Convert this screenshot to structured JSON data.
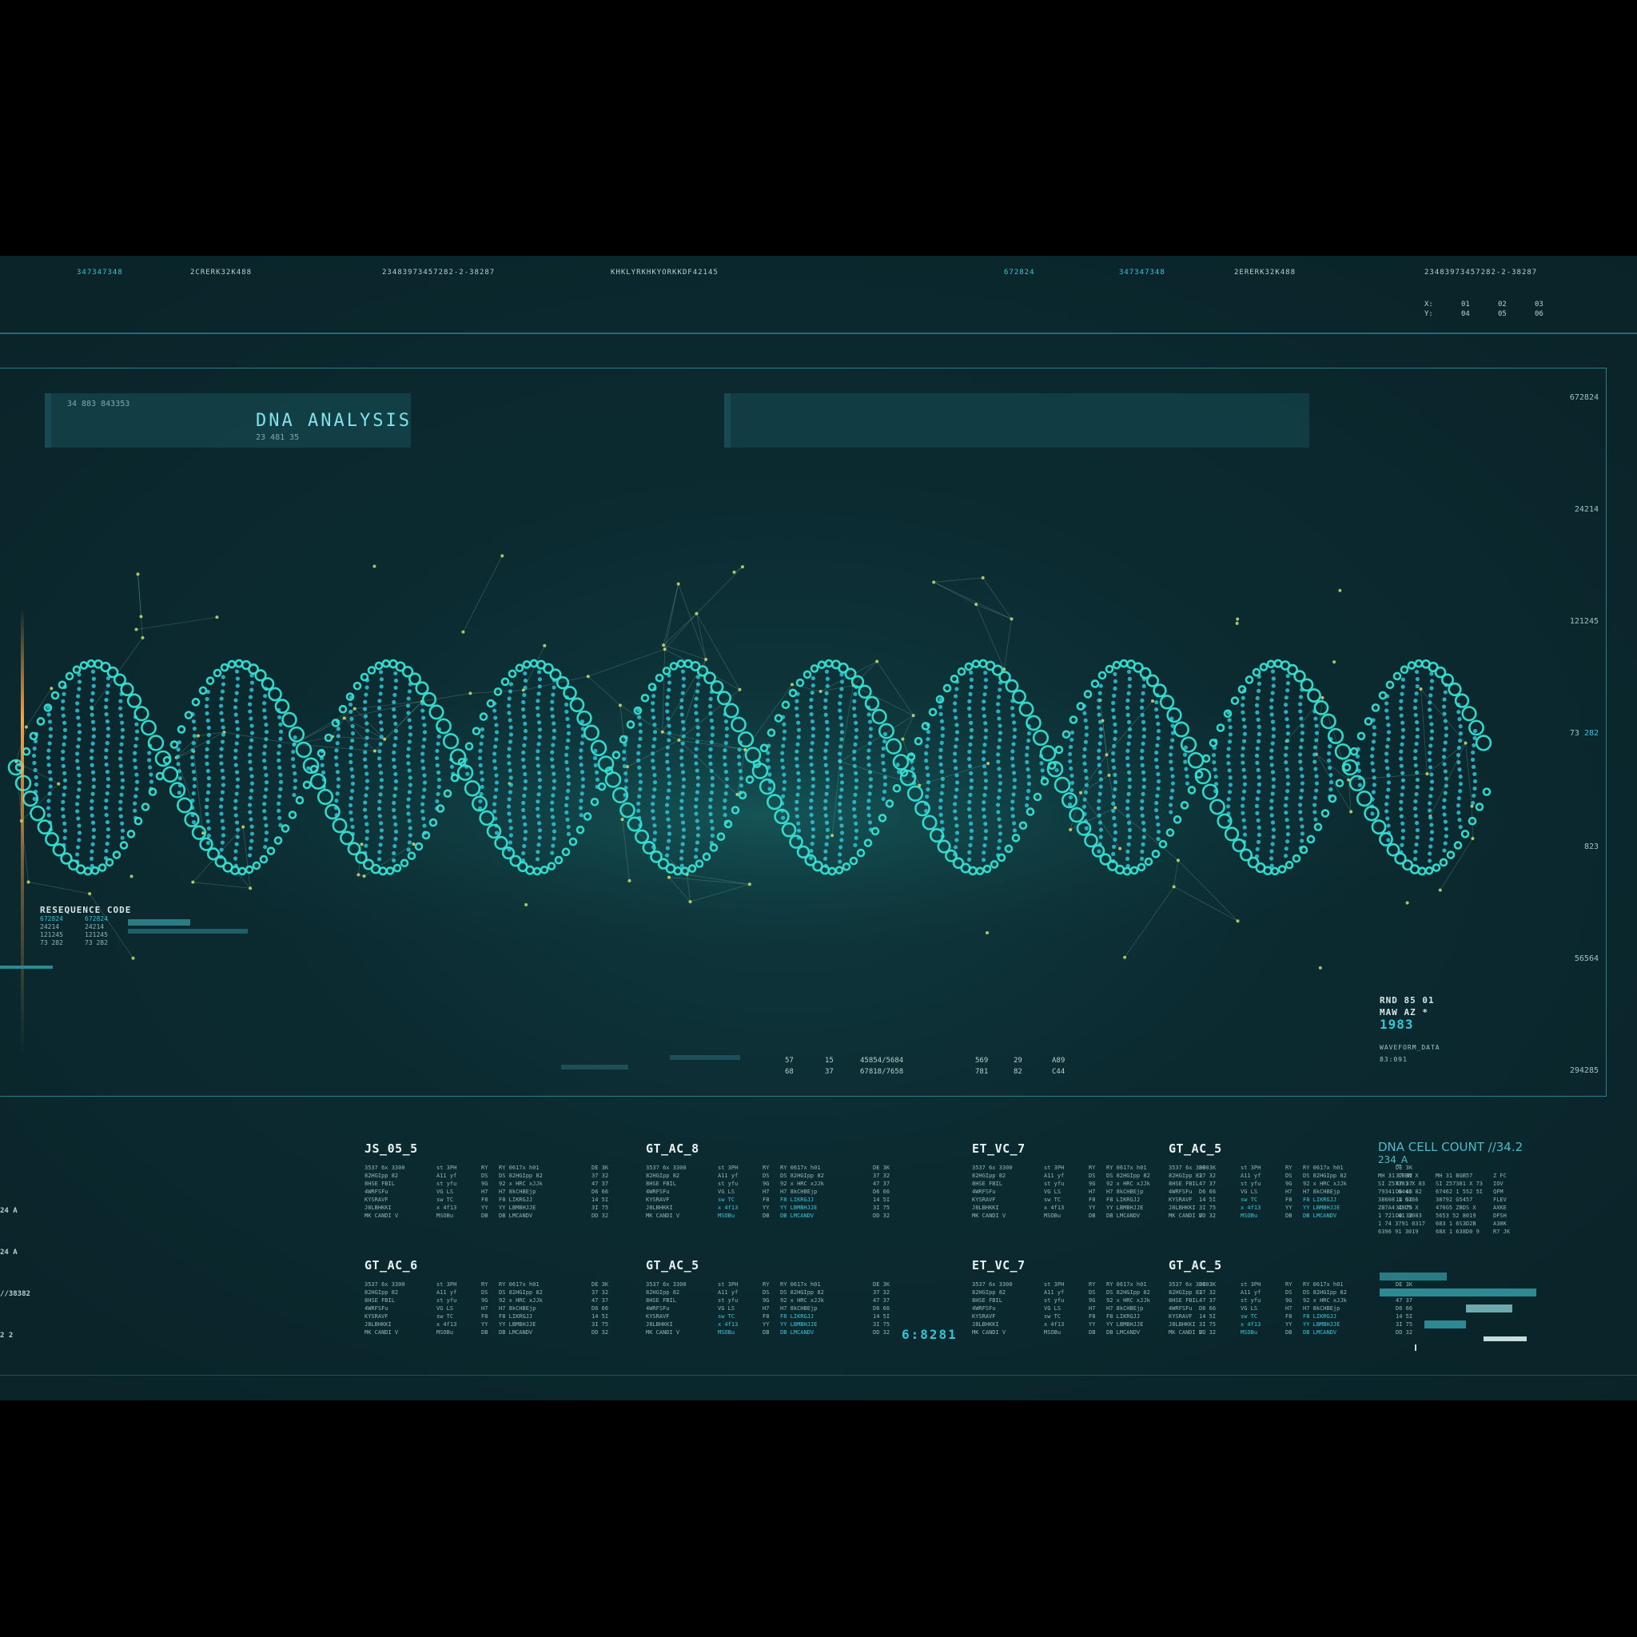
{
  "top_codes": [
    {
      "text": "347347348",
      "accent": true
    },
    {
      "text": "2CRERK32K488",
      "accent": false
    },
    {
      "text": "23483973457282-2-38287",
      "accent": false
    },
    {
      "text": "KHKLYRKHKYORKKDF42145",
      "accent": false
    },
    {
      "text": "672824",
      "accent": true
    },
    {
      "text": "347347348",
      "accent": true
    },
    {
      "text": "2ERERK32K488",
      "accent": false
    },
    {
      "text": "23483973457282-2-38287",
      "accent": false
    }
  ],
  "coords": {
    "x_label": "X:",
    "y_label": "Y:",
    "x_values": [
      "01",
      "02",
      "03"
    ],
    "y_values": [
      "04",
      "05",
      "06"
    ]
  },
  "title_panel": {
    "small_code": "34 883 843353",
    "title": "DNA ANALYSIS",
    "sub_code": "23 481 35"
  },
  "right_scale": [
    "672824",
    "24214",
    "121245",
    "73",
    "282",
    "823",
    "56564",
    "294285"
  ],
  "reseq": {
    "heading": "RESEQUENCE CODE",
    "rows": [
      [
        "672824",
        "672824"
      ],
      [
        "24214",
        "24214"
      ],
      [
        "121245",
        "121245"
      ],
      [
        "73 282",
        "73 282"
      ]
    ]
  },
  "readout": {
    "line1": "RND 85 01",
    "line2": "MAW AZ *",
    "value": "1983",
    "label": "WAVEFORM_DATA",
    "sublabel": "83:091"
  },
  "stats": {
    "col1": [
      "57",
      "68"
    ],
    "col2": [
      "15",
      "37"
    ],
    "col3": [
      "45854/5684",
      "67818/7658"
    ],
    "col4": [
      "569",
      "781"
    ],
    "col5": [
      "29",
      "82"
    ],
    "col6": [
      "A89",
      "C44"
    ]
  },
  "blocks": [
    {
      "title": "JS_05_5"
    },
    {
      "title": "GT_AC_8"
    },
    {
      "title": "ET_VC_7"
    },
    {
      "title": "GT_AC_5"
    },
    {
      "title": "GT_AC_6"
    },
    {
      "title": "GT_AC_5"
    },
    {
      "title": "ET_VC_7"
    },
    {
      "title": "GT_AC_5"
    }
  ],
  "block_table": [
    [
      "3537 6x 3300",
      "st 3PH",
      "RY",
      "RY 0617x h01",
      "DE 3K"
    ],
    [
      "82HGIpp 82",
      "A11 yf",
      "DS",
      "DS 82HGIpp 82",
      "37 32"
    ],
    [
      "8HSE FBIL",
      "st yfu",
      "9G",
      "92 x HRC xJJk",
      "47 37"
    ],
    [
      "4WRFSFu",
      "VG LS",
      "H7",
      "H7 8kCHBEjp",
      "D6 66"
    ],
    [
      "KYSRAVF",
      "sw TC",
      "F8",
      "F8 LIKRGJJ",
      "14 5I"
    ],
    [
      "J8LBHKKI",
      "x 4f13",
      "YY",
      "YY LBMBHJJE",
      "3I 75"
    ],
    [
      "MK CANDI V",
      "MSOBu",
      "DB",
      "DB LMCANDV",
      "DD 32"
    ]
  ],
  "cell_count": {
    "title": "DNA CELL COUNT //34.2",
    "subtitle": "234_A",
    "rows": [
      [
        "MH 31 CBBM X",
        "MH 31 BGB57",
        "Z FC"
      ],
      [
        "SI Z57381 X 83",
        "SI Z57381 X 73",
        "IOV"
      ],
      [
        "79341 G441 82",
        "67462 1 552 5I",
        "QFM"
      ],
      [
        "38608 1 6766",
        "38792 G5457",
        "FLEV"
      ],
      [
        "ZB7A4 A8DS X",
        "476G5 ZBDS X",
        "AXKE"
      ],
      [
        "1 721 41 3083",
        "5653 52 8019",
        "DFSH"
      ],
      [
        "1 74 3791 0317",
        "683 1 6S3D2B",
        "A38K"
      ],
      [
        "6396 91 3019",
        "68X 1 638D0 9",
        "R7 JK"
      ]
    ]
  },
  "timer": "6:8281",
  "left_cut": [
    "24 A",
    "24 A",
    "//38382",
    "2 2"
  ],
  "colors": {
    "background": "#0b2b31",
    "accent": "#33c6d8",
    "helix": "#35e0d2",
    "orange": "#ffaa50"
  }
}
